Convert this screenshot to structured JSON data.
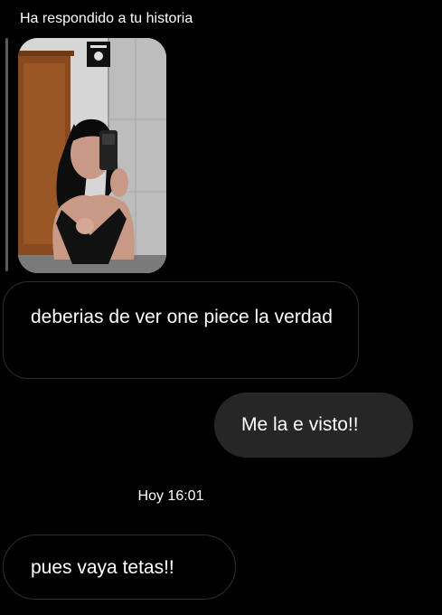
{
  "story_reply": {
    "header": "Ha respondido a tu historia",
    "thumbnail": "story-photo"
  },
  "messages": [
    {
      "direction": "incoming",
      "text": "deberias de ver one piece la verdad"
    },
    {
      "direction": "outgoing",
      "text": "Me la e visto!!"
    },
    {
      "direction": "incoming",
      "text": "pues vaya tetas!!"
    }
  ],
  "timestamp": "Hoy 16:01",
  "colors": {
    "background": "#000000",
    "outgoing_bubble": "#262626",
    "incoming_border": "#2e2e2e"
  }
}
